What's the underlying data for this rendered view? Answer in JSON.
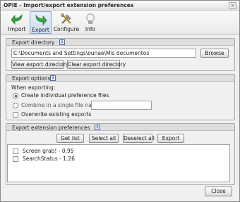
{
  "window": {
    "title": "OPIE - Import/export extension preferences",
    "close_glyph": "×"
  },
  "toolbar": {
    "items": [
      {
        "label": "Import",
        "icon": "import-arrow-icon"
      },
      {
        "label": "Export",
        "icon": "export-arrow-icon",
        "active": true
      },
      {
        "label": "Configure",
        "icon": "configure-tools-icon"
      },
      {
        "label": "Info",
        "icon": "info-bulb-icon"
      }
    ]
  },
  "export_directory": {
    "title": "Export directory",
    "path": "C:\\Documents and Settings\\ounae\\Mis documentos",
    "browse_label": "Browse",
    "view_label": "View export directory",
    "clear_label": "Clear export directory"
  },
  "export_options": {
    "title": "Export options",
    "when_label": "When exporting:",
    "individual_label": "Create individual preference files",
    "combine_label": "Combine in a single file named",
    "combine_value": "",
    "overwrite_label": "Overwrite existing exports"
  },
  "export_extension_prefs": {
    "title": "Export extension preferences",
    "get_list_label": "Get list",
    "select_all_label": "Select all",
    "deselect_all_label": "Deselect all",
    "export_label": "Export",
    "items": [
      {
        "label": "Screen grab! - 0.95",
        "checked": false
      },
      {
        "label": "SearchStatus - 1.26",
        "checked": false
      }
    ]
  },
  "footer": {
    "close_label": "Close"
  },
  "info_badge": "i",
  "colors": {
    "accent": "#2b4f86",
    "active_tab": "#cddcf1",
    "group_header": "#dedede"
  }
}
